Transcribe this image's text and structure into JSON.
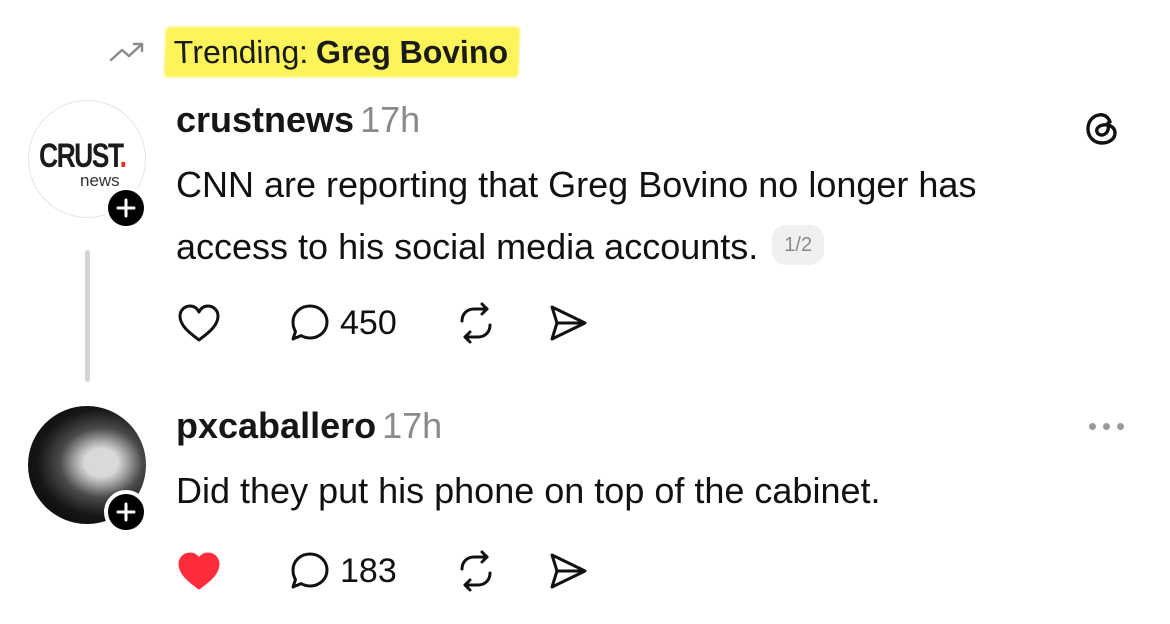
{
  "trending": {
    "icon": "trending-up-icon",
    "prefix": "Trending:",
    "topic": "Greg Bovino",
    "highlight_color": "#fdf35a"
  },
  "posts": [
    {
      "username": "crustnews",
      "time": "17h",
      "avatar": {
        "wordmark": "CRUST",
        "wordmark_dot": ".",
        "sub": "news"
      },
      "text_lines": [
        "CNN are reporting that Greg Bovino no longer has",
        "access to his social media accounts."
      ],
      "page_indicator": "1/2",
      "corner_icon": "threads-logo-icon",
      "liked": false,
      "reply_count": "450"
    },
    {
      "username": "pxcaballero",
      "time": "17h",
      "avatar": "profile-photo",
      "text_lines": [
        "Did they put his phone on top of the cabinet."
      ],
      "corner_icon": "more-options-icon",
      "liked": true,
      "like_color": "#ff2d3c",
      "reply_count": "183"
    }
  ]
}
